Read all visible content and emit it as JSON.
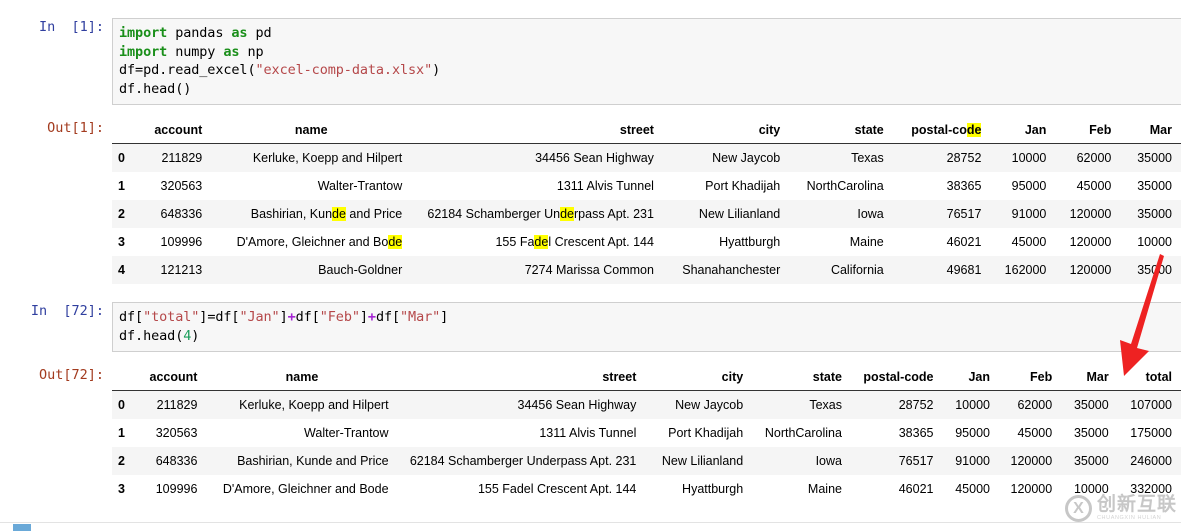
{
  "cells": [
    {
      "kind": "code",
      "prompt": "In  [1]:",
      "source_lines": [
        "import pandas as pd",
        "import numpy as np",
        "df=pd.read_excel(\"excel-comp-data.xlsx\")",
        "df.head()"
      ]
    },
    {
      "kind": "output",
      "prompt": "Out[1]:",
      "table": {
        "index_header": "",
        "columns": [
          "account",
          "name",
          "street",
          "city",
          "state",
          "postal-code",
          "Jan",
          "Feb",
          "Mar"
        ],
        "highlighted_column": "postal-code",
        "rows": [
          {
            "index": "0",
            "account": "211829",
            "name": "Kerluke, Koepp and Hilpert",
            "street": "34456 Sean Highway",
            "city": "New Jaycob",
            "state": "Texas",
            "postal-code": "28752",
            "Jan": "10000",
            "Feb": "62000",
            "Mar": "35000"
          },
          {
            "index": "1",
            "account": "320563",
            "name": "Walter-Trantow",
            "street": "1311 Alvis Tunnel",
            "city": "Port Khadijah",
            "state": "NorthCarolina",
            "postal-code": "38365",
            "Jan": "95000",
            "Feb": "45000",
            "Mar": "35000"
          },
          {
            "index": "2",
            "account": "648336",
            "name": "Bashirian, Kunde and Price",
            "street": "62184 Schamberger Underpass Apt. 231",
            "city": "New Lilianland",
            "state": "Iowa",
            "postal-code": "76517",
            "Jan": "91000",
            "Feb": "120000",
            "Mar": "35000"
          },
          {
            "index": "3",
            "account": "109996",
            "name": "D'Amore, Gleichner and Bode",
            "street": "155 Fadel Crescent Apt. 144",
            "city": "Hyattburgh",
            "state": "Maine",
            "postal-code": "46021",
            "Jan": "45000",
            "Feb": "120000",
            "Mar": "10000"
          },
          {
            "index": "4",
            "account": "121213",
            "name": "Bauch-Goldner",
            "street": "7274 Marissa Common",
            "city": "Shanahanchester",
            "state": "California",
            "postal-code": "49681",
            "Jan": "162000",
            "Feb": "120000",
            "Mar": "35000"
          }
        ]
      }
    },
    {
      "kind": "code",
      "prompt": "In  [72]:",
      "source_lines": [
        "df[\"total\"]=df[\"Jan\"]+df[\"Feb\"]+df[\"Mar\"]",
        "df.head(4)"
      ]
    },
    {
      "kind": "output",
      "prompt": "Out[72]:",
      "table": {
        "index_header": "",
        "columns": [
          "account",
          "name",
          "street",
          "city",
          "state",
          "postal-code",
          "Jan",
          "Feb",
          "Mar",
          "total"
        ],
        "highlighted_column": null,
        "rows": [
          {
            "index": "0",
            "account": "211829",
            "name": "Kerluke, Koepp and Hilpert",
            "street": "34456 Sean Highway",
            "city": "New Jaycob",
            "state": "Texas",
            "postal-code": "28752",
            "Jan": "10000",
            "Feb": "62000",
            "Mar": "35000",
            "total": "107000"
          },
          {
            "index": "1",
            "account": "320563",
            "name": "Walter-Trantow",
            "street": "1311 Alvis Tunnel",
            "city": "Port Khadijah",
            "state": "NorthCarolina",
            "postal-code": "38365",
            "Jan": "95000",
            "Feb": "45000",
            "Mar": "35000",
            "total": "175000"
          },
          {
            "index": "2",
            "account": "648336",
            "name": "Bashirian, Kunde and Price",
            "street": "62184 Schamberger Underpass Apt. 231",
            "city": "New Lilianland",
            "state": "Iowa",
            "postal-code": "76517",
            "Jan": "91000",
            "Feb": "120000",
            "Mar": "35000",
            "total": "246000"
          },
          {
            "index": "3",
            "account": "109996",
            "name": "D'Amore, Gleichner and Bode",
            "street": "155 Fadel Crescent Apt. 144",
            "city": "Hyattburgh",
            "state": "Maine",
            "postal-code": "46021",
            "Jan": "45000",
            "Feb": "120000",
            "Mar": "10000",
            "total": "332000"
          }
        ]
      }
    }
  ],
  "annotation": {
    "name": "red-arrow",
    "color": "#ee2222",
    "points_to": "total"
  },
  "watermark": {
    "badge": "X",
    "chinese": "创新互联",
    "subtitle": "CHUANGXIN HULIAN"
  },
  "colors": {
    "code_bg": "#f7f7f7",
    "keyword": "#1a8f1a",
    "string": "#b5484a",
    "operator": "#a626d4",
    "number": "#1a9e5a",
    "in_prompt": "#303f9f",
    "out_prompt": "#a33b1f",
    "highlight": "#ffff00",
    "row_stripe": "#f5f5f5"
  }
}
